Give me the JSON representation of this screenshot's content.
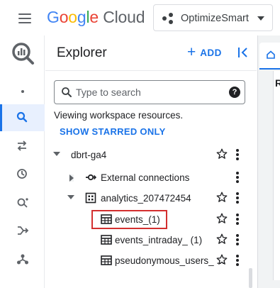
{
  "header": {
    "menu_icon": "hamburger-menu-icon",
    "logo": {
      "letters": [
        "G",
        "o",
        "o",
        "g",
        "l",
        "e"
      ],
      "product": "Cloud"
    },
    "project_selector": {
      "icon": "project-dots-icon",
      "name": "OptimizeSmart",
      "caret_icon": "caret-down-icon"
    }
  },
  "rail": {
    "logo_icon": "bigquery-logo-icon",
    "items": [
      {
        "icon": "search-icon",
        "active": true
      },
      {
        "icon": "transfers-icon",
        "active": false
      },
      {
        "icon": "scheduled-queries-icon",
        "active": false
      },
      {
        "icon": "analytics-hub-icon",
        "active": false
      },
      {
        "icon": "dataform-icon",
        "active": false
      },
      {
        "icon": "partner-center-icon",
        "active": false
      }
    ]
  },
  "explorer": {
    "title": "Explorer",
    "add_label": "ADD",
    "collapse_icon": "collapse-left-icon",
    "search": {
      "placeholder": "Type to search",
      "value": ""
    },
    "help_glyph": "?",
    "viewing_text": "Viewing workspace resources.",
    "starred_label": "SHOW STARRED ONLY",
    "tree": [
      {
        "label": "dbrt-ga4",
        "level": 0,
        "expand": "down",
        "icon": null,
        "star": true
      },
      {
        "label": "External connections",
        "level": 1,
        "expand": "right",
        "icon": "external-connection-icon",
        "star": false
      },
      {
        "label": "analytics_207472454",
        "level": 1,
        "expand": "down",
        "icon": "dataset-icon",
        "star": true
      },
      {
        "label": "events_(1)",
        "level": 2,
        "expand": null,
        "icon": "table-icon",
        "star": true,
        "highlighted": true
      },
      {
        "label": "events_intraday_ (1)",
        "level": 2,
        "expand": null,
        "icon": "table-icon",
        "star": true
      },
      {
        "label": "pseudonymous_users_ ...",
        "level": 2,
        "expand": null,
        "icon": "table-icon",
        "star": true
      }
    ]
  },
  "right_panel": {
    "tab_icon": "home-icon",
    "partial_text": "R"
  },
  "colors": {
    "accent": "#1a73e8",
    "highlight_border": "#d32f2f",
    "rail_active_bg": "#e8f0fe"
  }
}
